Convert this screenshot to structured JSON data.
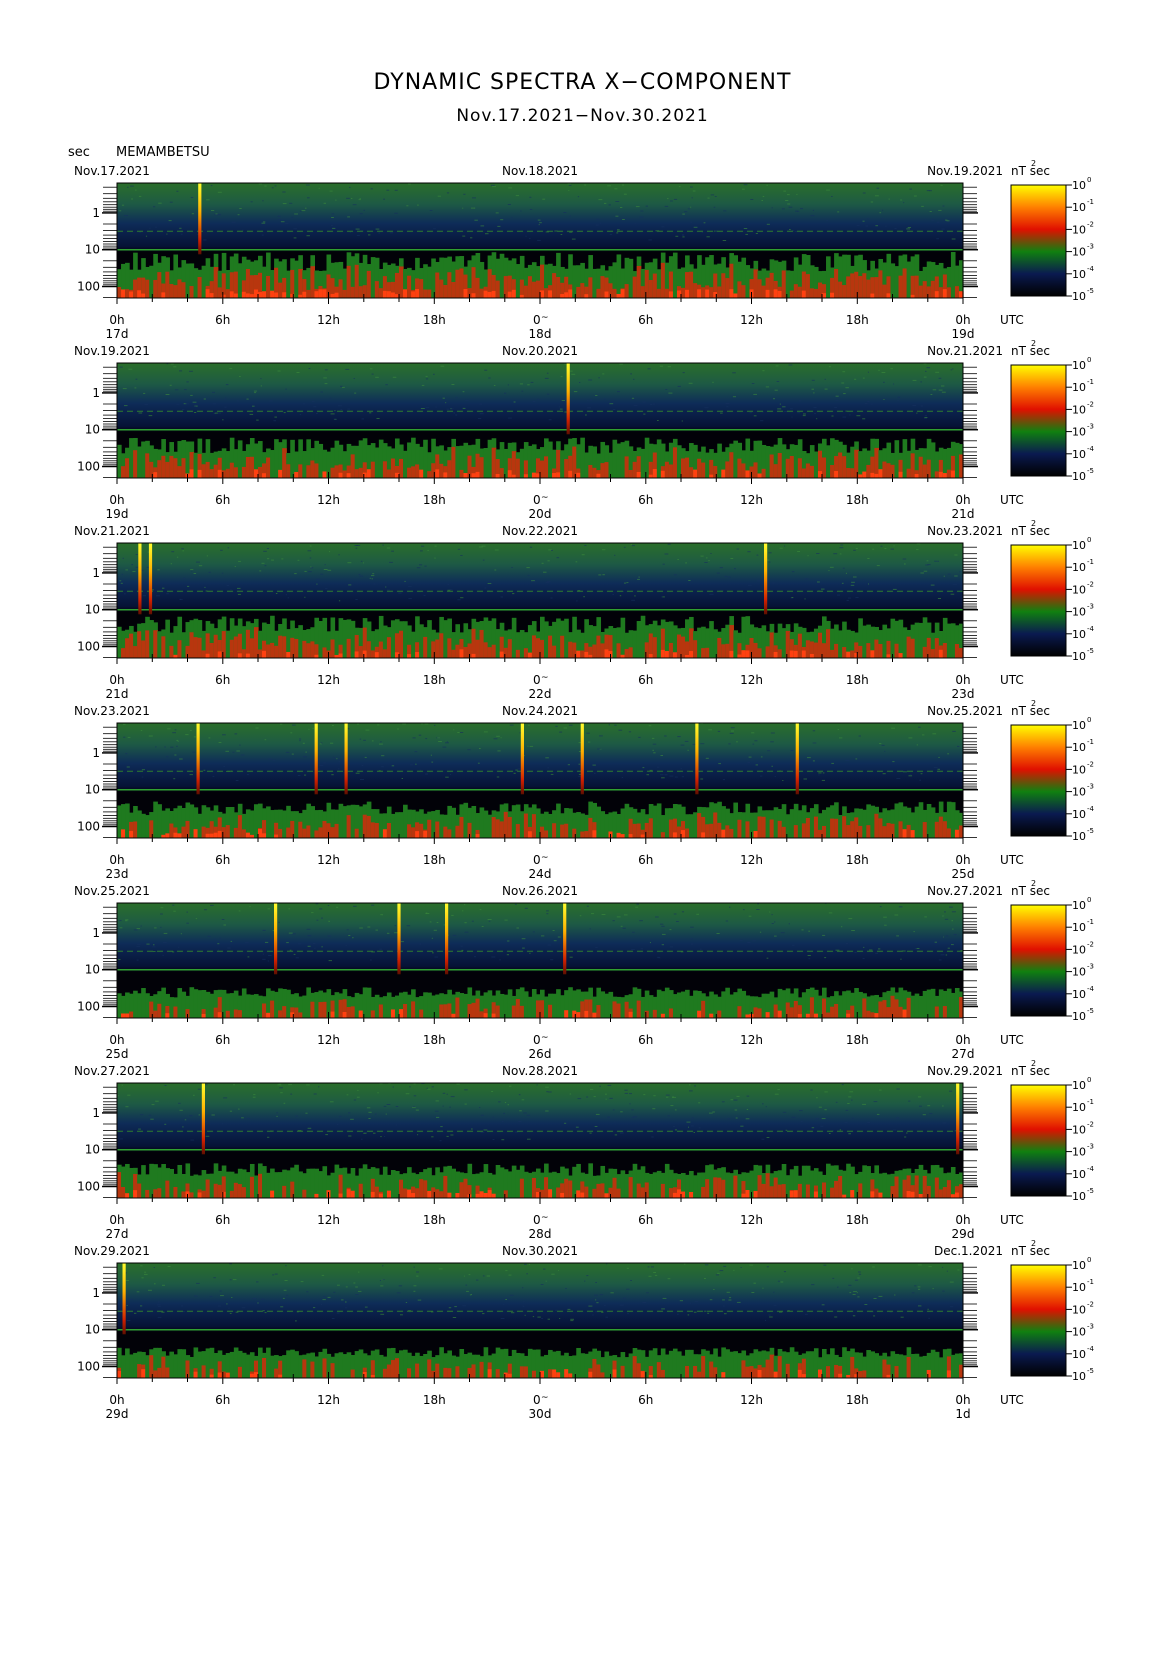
{
  "header": {
    "title": "DYNAMIC SPECTRA X−COMPONENT",
    "subtitle": "Nov.17.2021−Nov.30.2021",
    "unit_label": "sec",
    "station": "MEMAMBETSU"
  },
  "chart_data": {
    "type": "heatmap",
    "title": "DYNAMIC SPECTRA X−COMPONENT",
    "subtitle": "Nov.17.2021−Nov.30.2021",
    "ylabel": "sec",
    "y_scale": "log",
    "y_ticks": [
      "1",
      "10",
      "100"
    ],
    "x_ticks": [
      "0h",
      "6h",
      "12h",
      "18h",
      "0h",
      "6h",
      "12h",
      "18h",
      "0h"
    ],
    "x_center_tick": "0",
    "time_zone": "UTC",
    "colorbar": {
      "unit": "nT  sec",
      "unit_exponent": "2",
      "scale": "log",
      "labels": [
        "10",
        "10",
        "10",
        "10",
        "10",
        "10"
      ],
      "exponents": [
        "0",
        "-1",
        "-2",
        "-3",
        "-4",
        "-5"
      ],
      "colors": [
        "#ffff00",
        "#ff8000",
        "#e01000",
        "#108010",
        "#0a1a50",
        "#000000"
      ]
    },
    "panels": [
      {
        "date_left": "Nov.17.2021",
        "date_center": "Nov.18.2021",
        "date_right": "Nov.19.2021",
        "day_left": "17d",
        "day_center": "18d",
        "day_right": "19d",
        "spikes_hours": [
          4.7
        ],
        "activity_level": 0.85
      },
      {
        "date_left": "Nov.19.2021",
        "date_center": "Nov.20.2021",
        "date_right": "Nov.21.2021",
        "day_left": "19d",
        "day_center": "20d",
        "day_right": "21d",
        "spikes_hours": [
          25.6
        ],
        "activity_level": 0.7
      },
      {
        "date_left": "Nov.21.2021",
        "date_center": "Nov.22.2021",
        "date_right": "Nov.23.2021",
        "day_left": "21d",
        "day_center": "22d",
        "day_right": "23d",
        "spikes_hours": [
          1.3,
          1.9,
          36.8
        ],
        "activity_level": 0.75
      },
      {
        "date_left": "Nov.23.2021",
        "date_center": "Nov.24.2021",
        "date_right": "Nov.25.2021",
        "day_left": "23d",
        "day_center": "24d",
        "day_right": "25d",
        "spikes_hours": [
          4.6,
          11.3,
          13.0,
          23.0,
          26.4,
          32.9,
          38.6
        ],
        "activity_level": 0.6
      },
      {
        "date_left": "Nov.25.2021",
        "date_center": "Nov.26.2021",
        "date_right": "Nov.27.2021",
        "day_left": "25d",
        "day_center": "26d",
        "day_right": "27d",
        "spikes_hours": [
          9.0,
          16.0,
          18.7,
          25.4
        ],
        "activity_level": 0.45
      },
      {
        "date_left": "Nov.27.2021",
        "date_center": "Nov.28.2021",
        "date_right": "Nov.29.2021",
        "day_left": "27d",
        "day_center": "28d",
        "day_right": "29d",
        "spikes_hours": [
          4.9,
          47.7
        ],
        "activity_level": 0.55
      },
      {
        "date_left": "Nov.29.2021",
        "date_center": "Nov.30.2021",
        "date_right": "Dec.1.2021",
        "day_left": "29d",
        "day_center": "30d",
        "day_right": "1d",
        "spikes_hours": [
          0.4
        ],
        "activity_level": 0.45
      }
    ]
  }
}
